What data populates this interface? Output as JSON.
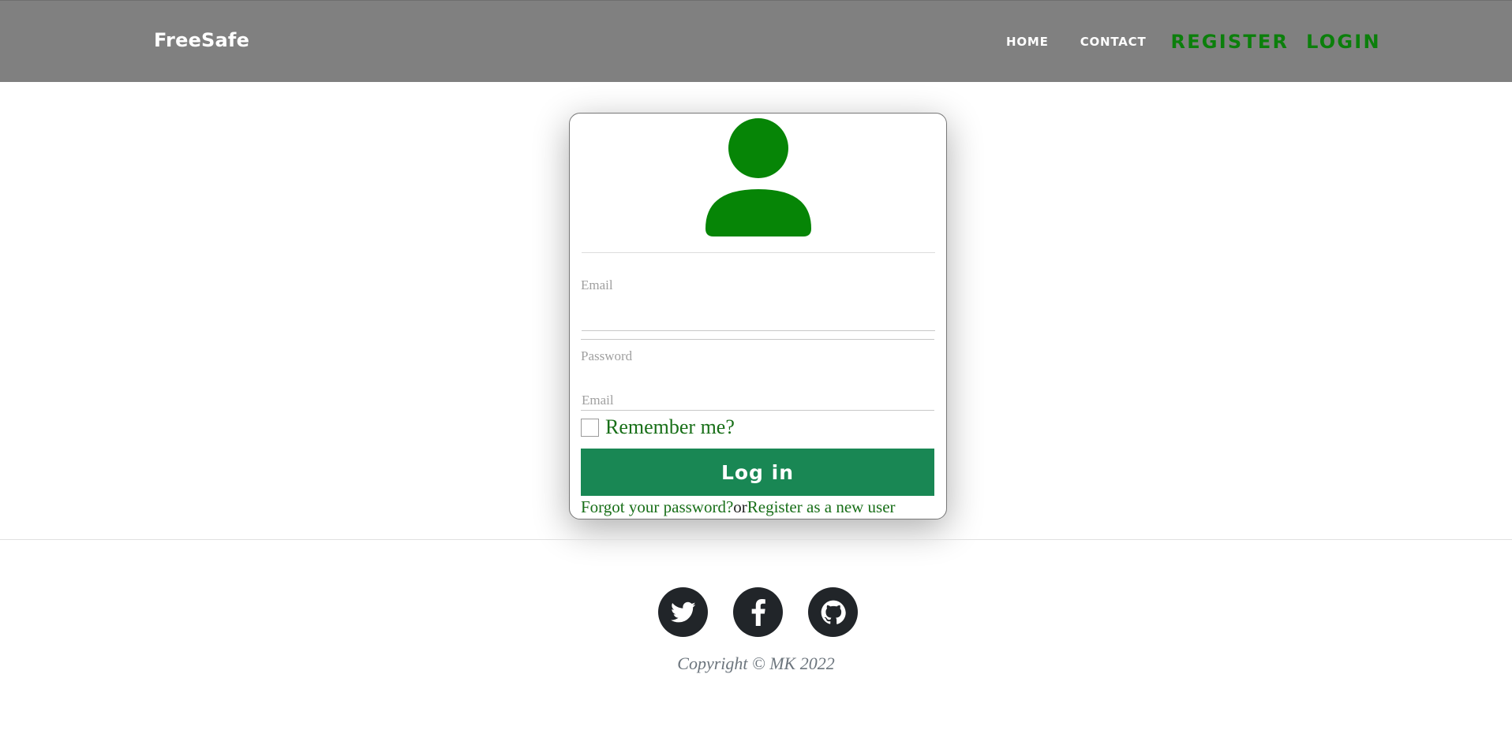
{
  "navbar": {
    "brand": "FreeSafe",
    "links": {
      "home": "HOME",
      "contact": "CONTACT",
      "register": "REGISTER",
      "login": "LOGIN"
    }
  },
  "login_form": {
    "avatar_icon": "user-icon",
    "email_label": "Email",
    "email_value": "",
    "password_label": "Password",
    "password_value": "",
    "remember_label": "Remember me?",
    "remember_checked": false,
    "submit_label": "Log in",
    "forgot_link": "Forgot your password?",
    "or_text": "or",
    "register_link": "Register as a new user"
  },
  "footer": {
    "social": [
      "twitter-icon",
      "facebook-icon",
      "github-icon"
    ],
    "copyright": "Copyright © MK 2022"
  },
  "colors": {
    "navbar_bg": "#808080",
    "brand_green": "#0b7f0b",
    "button_green": "#198754",
    "social_bg": "#212529"
  }
}
